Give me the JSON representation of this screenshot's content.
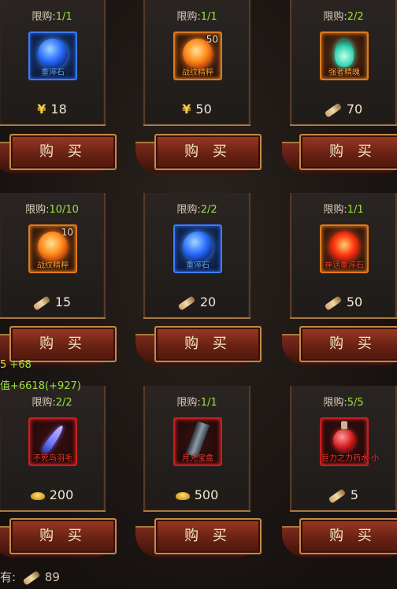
{
  "shop": {
    "items": [
      {
        "limit_label": "限购:",
        "limit_num": "1/1",
        "name": "重淬石",
        "count": "",
        "price": "18",
        "currency": "yen",
        "slot": "blue",
        "icon": "blue-orb-icon"
      },
      {
        "limit_label": "限购:",
        "limit_num": "1/1",
        "name": "战纹精粹",
        "count": "50",
        "price": "50",
        "currency": "yen",
        "slot": "orange",
        "icon": "fire-orb-icon"
      },
      {
        "limit_label": "限购:",
        "limit_num": "2/2",
        "name": "强者精魄",
        "count": "",
        "price": "70",
        "currency": "scroll",
        "slot": "orange",
        "icon": "spirit-flame-icon"
      },
      {
        "limit_label": "限购:",
        "limit_num": "10/10",
        "name": "战纹精粹",
        "count": "10",
        "price": "15",
        "currency": "scroll",
        "slot": "orange",
        "icon": "fire-orb-icon"
      },
      {
        "limit_label": "限购:",
        "limit_num": "2/2",
        "name": "重淬石",
        "count": "",
        "price": "20",
        "currency": "scroll",
        "slot": "blue",
        "icon": "blue-orb-icon"
      },
      {
        "limit_label": "限购:",
        "limit_num": "1/1",
        "name": "神话重淬石",
        "count": "",
        "price": "50",
        "currency": "scroll",
        "slot": "orange",
        "icon": "red-fire-orb-icon"
      },
      {
        "limit_label": "限购:",
        "limit_num": "2/2",
        "name": "不死鸟羽毛",
        "count": "",
        "price": "200",
        "currency": "ingot",
        "slot": "red",
        "icon": "feather-icon"
      },
      {
        "limit_label": "限购:",
        "limit_num": "1/1",
        "name": "月光宝盒",
        "count": "",
        "price": "500",
        "currency": "ingot",
        "slot": "red",
        "icon": "blade-icon"
      },
      {
        "limit_label": "限购:",
        "limit_num": "5/5",
        "name": "巨力之力药水·小",
        "count": "",
        "price": "5",
        "currency": "scroll",
        "slot": "red",
        "icon": "potion-icon"
      }
    ],
    "buy_label": "购 买",
    "yen_symbol": "¥"
  },
  "overlay": {
    "attr1_key": "5",
    "attr1_val": "+68",
    "attr2": "值+6618(+927)"
  },
  "footer": {
    "label": "有:",
    "value": "89"
  }
}
